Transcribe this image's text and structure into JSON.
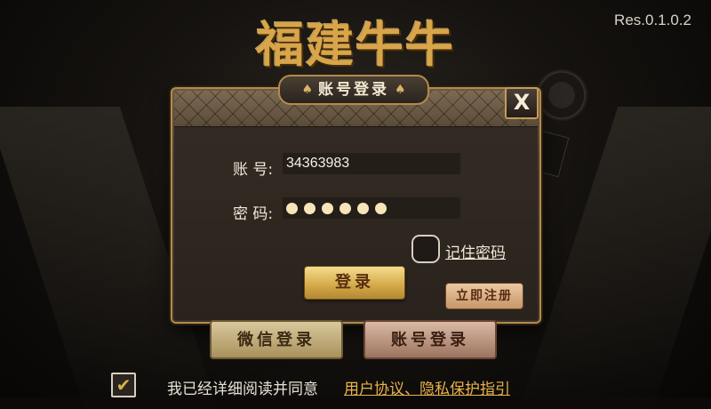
{
  "game_title": "福建牛牛",
  "version": "Res.0.1.0.2",
  "dialog": {
    "title": "账号登录",
    "close_label": "X",
    "account_label": "账 号:",
    "account_value": "34363983",
    "password_label": "密 码:",
    "password_dot_count": 6,
    "remember_label": "记住密码",
    "login_label": "登录",
    "register_label": "立即注册"
  },
  "bottom": {
    "wechat_login_label": "微信登录",
    "account_login_label": "账号登录",
    "agreement_text": "我已经详细阅读并同意",
    "agreement_link": "用户协议、隐私保护指引",
    "agreement_checked": true
  },
  "colors": {
    "gold": "#d9a54a",
    "link": "#e9b34a",
    "dialog_border": "#b58a4a"
  }
}
